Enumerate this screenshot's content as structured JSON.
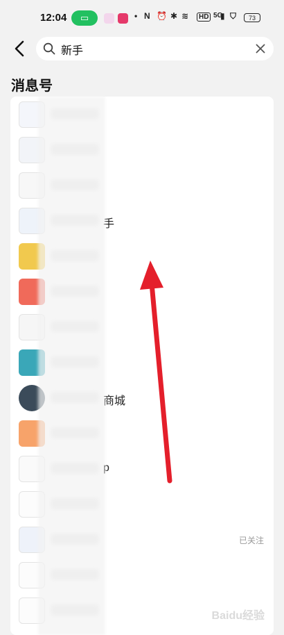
{
  "status_bar": {
    "time": "12:04",
    "battery": "73",
    "network_label": "5G",
    "hd_label": "HD"
  },
  "search": {
    "query": "新手",
    "placeholder": "搜索"
  },
  "section_title": "消息号",
  "accounts": [
    {
      "name_tail": "",
      "followed": ""
    },
    {
      "name_tail": "",
      "followed": ""
    },
    {
      "name_tail": "",
      "followed": ""
    },
    {
      "name_tail": "手",
      "followed": ""
    },
    {
      "name_tail": "",
      "followed": ""
    },
    {
      "name_tail": "",
      "followed": ""
    },
    {
      "name_tail": "",
      "followed": ""
    },
    {
      "name_tail": "",
      "followed": ""
    },
    {
      "name_tail": "商城",
      "followed": ""
    },
    {
      "name_tail": "",
      "followed": ""
    },
    {
      "name_tail": "p",
      "followed": ""
    },
    {
      "name_tail": "",
      "followed": ""
    },
    {
      "name_tail": "",
      "followed": "已关注"
    },
    {
      "name_tail": "",
      "followed": ""
    },
    {
      "name_tail": "",
      "followed": ""
    }
  ],
  "colors": {
    "accent_green": "#22c060",
    "annotation_arrow": "#e41f2b"
  },
  "watermark": "Baidu经验"
}
